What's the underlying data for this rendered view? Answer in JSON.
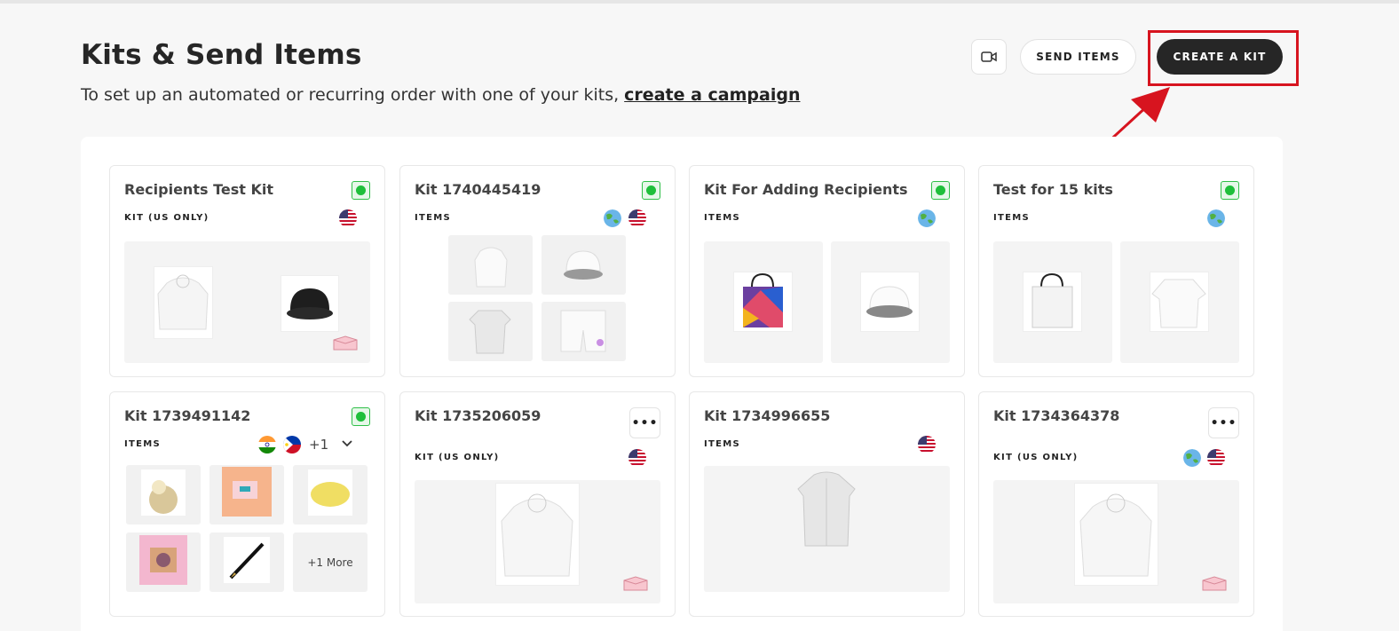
{
  "header": {
    "title": "Kits & Send Items",
    "subtitle_prefix": "To set up an automated or recurring order with one of your kits, ",
    "subtitle_link": "create a campaign",
    "send_items_label": "SEND ITEMS",
    "create_kit_label": "CREATE A KIT",
    "video_icon": "video-camera-icon"
  },
  "cards": [
    {
      "title": "Recipients Test Kit",
      "type": "KIT (US ONLY)"
    },
    {
      "title": "Kit 1740445419",
      "type": "ITEMS"
    },
    {
      "title": "Kit For Adding Recipients",
      "type": "ITEMS"
    },
    {
      "title": "Test for 15 kits",
      "type": "ITEMS"
    },
    {
      "title": "Kit 1739491142",
      "type": "ITEMS",
      "extra_flags": "+1",
      "more_items": "+1 More"
    },
    {
      "title": "Kit 1735206059",
      "type": "KIT (US ONLY)"
    },
    {
      "title": "Kit 1734996655",
      "type": "ITEMS"
    },
    {
      "title": "Kit 1734364378",
      "type": "KIT (US ONLY)"
    }
  ],
  "colors": {
    "accent_red": "#d7141f",
    "status_green": "#1fbf3b",
    "dark_button": "#262626"
  }
}
